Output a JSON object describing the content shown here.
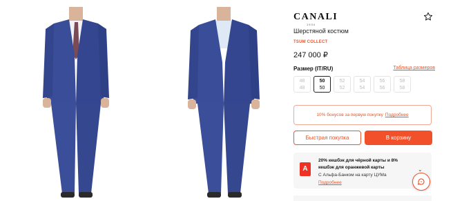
{
  "brand": {
    "name": "CANALI",
    "year": "1934"
  },
  "product": {
    "name": "Шерстяной костюм",
    "collection": "TSUM COLLECT",
    "price": "247 000 ₽"
  },
  "sizes": {
    "label": "Размер (IT/RU)",
    "table_link": "Таблица размеров",
    "items": [
      {
        "it": "48",
        "ru": "48",
        "selected": false
      },
      {
        "it": "50",
        "ru": "50",
        "selected": true
      },
      {
        "it": "52",
        "ru": "52",
        "selected": false
      },
      {
        "it": "54",
        "ru": "54",
        "selected": false
      },
      {
        "it": "56",
        "ru": "56",
        "selected": false
      },
      {
        "it": "58",
        "ru": "58",
        "selected": false
      }
    ]
  },
  "bonus": {
    "text": "10% бонусов за первую покупку",
    "link": "Подробнее"
  },
  "buttons": {
    "quick_buy": "Быстрая покупка",
    "add_to_cart": "В корзину"
  },
  "cashback": {
    "title": "20% кешбэк для чёрной карты и 8% кешбэк для оранжевой карты",
    "subtitle": "С Альфа-Банком на карту ЦУМа",
    "link": "Подробнее",
    "logo_letter": "А"
  },
  "colors": {
    "accent": "#f2502a",
    "suit": "#3d4f9a",
    "alfa": "#ef3124"
  },
  "icons": {
    "favorite": "star-outline-icon",
    "chat": "chat-icon",
    "chevron": "chevron-down-icon"
  }
}
